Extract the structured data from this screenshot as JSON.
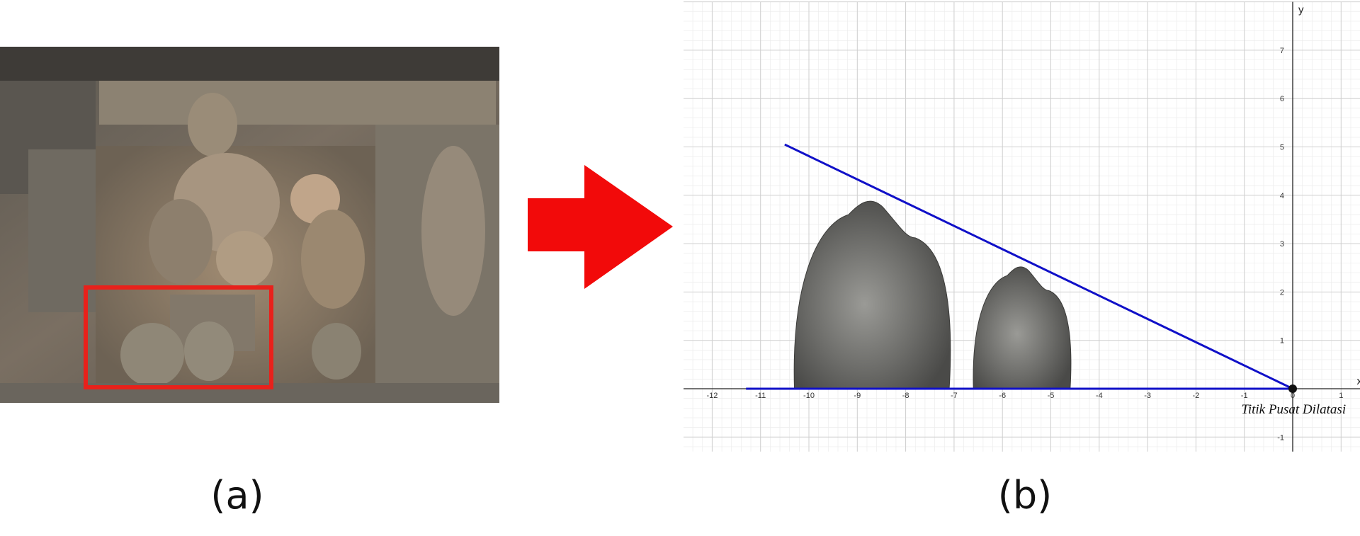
{
  "panel_labels": {
    "a": "(a)",
    "b": "(b)"
  },
  "colors": {
    "highlight_box": "#e8211b",
    "arrow": "#f20a0a",
    "lines": "#1010c8",
    "grid_major": "#cfcfcf",
    "grid_minor": "#ececec"
  },
  "photo": {
    "description_icon": "temple-relief-photo"
  },
  "graph": {
    "x_axis_label": "x",
    "y_axis_label": "y",
    "x_ticks": [
      "-12",
      "-11",
      "-10",
      "-9",
      "-8",
      "-7",
      "-6",
      "-5",
      "-4",
      "-3",
      "-2",
      "-1",
      "0",
      "1"
    ],
    "y_ticks": [
      "-1",
      "1",
      "2",
      "3",
      "4",
      "5",
      "6",
      "7"
    ],
    "center_label": "Titik Pusat Dilatasi"
  },
  "chart_data": {
    "type": "scatter",
    "xlim": [
      -12.6,
      1.5
    ],
    "ylim": [
      -1.3,
      8.0
    ],
    "grid": true,
    "center_of_dilation": [
      0,
      0
    ],
    "lines": [
      {
        "from": [
          -10.5,
          5.05
        ],
        "to": [
          0,
          0
        ]
      },
      {
        "from": [
          -11.3,
          0
        ],
        "to": [
          0,
          0
        ]
      }
    ],
    "objects": [
      {
        "name": "large",
        "x_range": [
          -10.3,
          -7.1
        ],
        "top": 4.0
      },
      {
        "name": "small",
        "x_range": [
          -6.6,
          -4.6
        ],
        "top": 2.6
      }
    ]
  }
}
